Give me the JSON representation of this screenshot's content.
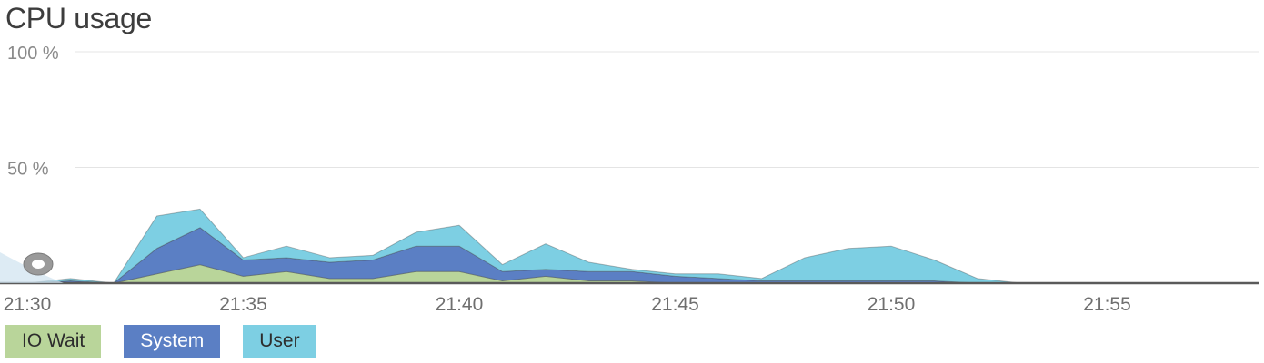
{
  "header": {
    "title": "CPU usage"
  },
  "chart_data": {
    "type": "area",
    "stacked": true,
    "title": "CPU usage",
    "x_labels": [
      "21:30",
      "21:35",
      "21:40",
      "21:45",
      "21:50",
      "21:55"
    ],
    "y_ticks": [
      "100 %",
      "50 %"
    ],
    "ylim": [
      0,
      100
    ],
    "grid": true,
    "legend_position": "bottom-left",
    "x": [
      "21:31",
      "21:32",
      "21:33",
      "21:34",
      "21:35",
      "21:36",
      "21:37",
      "21:38",
      "21:39",
      "21:40",
      "21:41",
      "21:42",
      "21:43",
      "21:44",
      "21:45",
      "21:46",
      "21:47",
      "21:48",
      "21:49",
      "21:50",
      "21:51",
      "21:52",
      "21:53",
      "21:54",
      "21:55",
      "21:56",
      "21:57",
      "21:58"
    ],
    "series": [
      {
        "name": "IO Wait",
        "color": "#b9d59a",
        "values": [
          0,
          0,
          4,
          8,
          3,
          5,
          2,
          2,
          5,
          5,
          1,
          3,
          1,
          1,
          0,
          0,
          0,
          0,
          0,
          0,
          0,
          0,
          0,
          0,
          0,
          0,
          0,
          0
        ]
      },
      {
        "name": "System",
        "color": "#5b7fc4",
        "values": [
          1,
          0,
          11,
          16,
          7,
          6,
          7,
          8,
          11,
          11,
          4,
          3,
          4,
          4,
          3,
          2,
          1,
          1,
          1,
          1,
          1,
          0,
          0,
          0,
          0,
          0,
          0,
          0
        ]
      },
      {
        "name": "User",
        "color": "#7dcfe3",
        "values": [
          1,
          0,
          14,
          8,
          1,
          5,
          2,
          2,
          6,
          9,
          3,
          11,
          4,
          1,
          1,
          2,
          1,
          10,
          14,
          15,
          9,
          2,
          0,
          0,
          0,
          0,
          0,
          0
        ]
      }
    ]
  }
}
